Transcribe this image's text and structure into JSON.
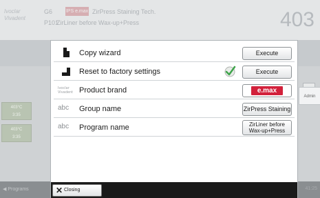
{
  "background": {
    "brand_text": "Ivoclar Vivadent",
    "program_code_1": "G6",
    "badge_text": "IPS e.max",
    "program_title_1": "ZirPress Staining Tech.",
    "program_code_2": "P101",
    "program_title_2": "ZirLiner before Wax-up+Press",
    "large_number": "403",
    "tab_label": "Admin",
    "slot_1": [
      "403°C",
      "3:35"
    ],
    "slot_2": [
      "403°C",
      "3:35"
    ],
    "footer_left": "◀ Programs",
    "footer_right": "41:25"
  },
  "dialog": {
    "rows": [
      {
        "label": "Copy wizard",
        "button": "Execute",
        "icon": "copy-icon"
      },
      {
        "label": "Reset to factory settings",
        "button": "Execute",
        "icon": "reset-icon",
        "status": "success-check-icon"
      },
      {
        "label": "Product brand",
        "button": "e.max",
        "icon": "brand-logo-icon"
      },
      {
        "label": "Group name",
        "icon_text": "abc",
        "button": "ZirPress Staining"
      },
      {
        "label": "Program name",
        "icon_text": "abc",
        "button_line1": "ZirLiner before",
        "button_line2": "Wax-up+Press"
      }
    ],
    "close_label": "Closing"
  },
  "colors": {
    "brand_red": "#d2213b",
    "check_green": "#3ea34a",
    "footer_dark": "#1a1a1a"
  }
}
